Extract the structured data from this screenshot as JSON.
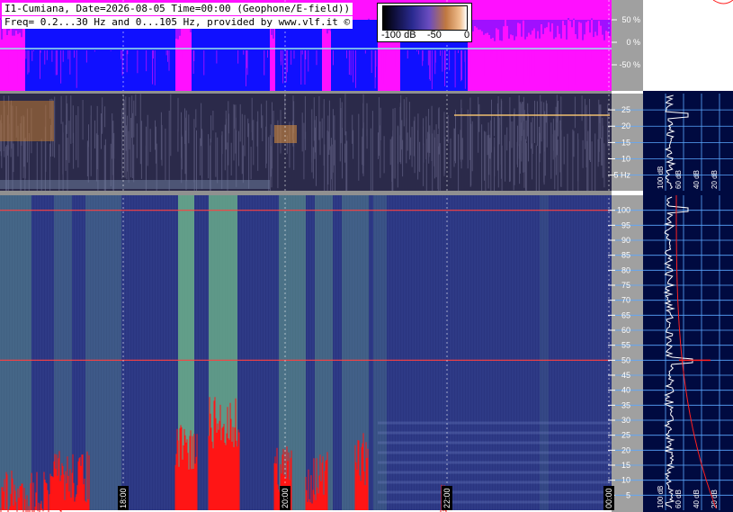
{
  "header": {
    "line1": "I1-Cumiana, Date=2026-08-05 Time=00:00 (Geophone/E-field))",
    "line2": "Freq= 0.2...30 Hz and 0...105 Hz, provided by www.vlf.it ©"
  },
  "colorscale": {
    "labels": [
      "-100 dB",
      "-50",
      "0"
    ]
  },
  "colors": {
    "spectrogram_bg": "#2a3580",
    "panel_bg": "#000a40",
    "grid": "#5aa8ff",
    "trace_red": "#ff2020",
    "percent_blue": "#1010ff",
    "percent_magenta": "#ff10ff",
    "gray_column": "#a0a0a0"
  },
  "chart_data": [
    {
      "type": "area",
      "name": "percentage panel",
      "ylabel": "%",
      "y_ticks": [
        "50 %",
        "0 %",
        "-50 %"
      ],
      "ylim": [
        -100,
        100
      ]
    },
    {
      "type": "heatmap",
      "name": "low-frequency spectrogram",
      "unit_label": "Hz",
      "y_ticks": [
        "25",
        "20",
        "15",
        "10",
        "5 Hz"
      ],
      "y_tick_values": [
        25,
        20,
        15,
        10,
        5
      ],
      "ylim": [
        0.2,
        30
      ],
      "x_ticks": [
        "18:00",
        "20:00",
        "22:00",
        "00:00"
      ],
      "profile_labels": [
        "100 dB",
        "60 dB",
        "40 dB",
        "20 dB"
      ]
    },
    {
      "type": "heatmap",
      "name": "0-105 Hz spectrogram",
      "y_ticks": [
        "100",
        "95",
        "90",
        "85",
        "80",
        "75",
        "70",
        "65",
        "60",
        "55",
        "50",
        "45",
        "40",
        "35",
        "30",
        "25",
        "20",
        "15",
        "10",
        "5"
      ],
      "y_tick_values": [
        100,
        95,
        90,
        85,
        80,
        75,
        70,
        65,
        60,
        55,
        50,
        45,
        40,
        35,
        30,
        25,
        20,
        15,
        10,
        5
      ],
      "ylim": [
        0,
        105
      ],
      "lines_hz": [
        50,
        100
      ],
      "x_ticks": [
        "18:00",
        "20:00",
        "22:00",
        "00:00"
      ],
      "profile_labels": [
        "100 dB",
        "60 dB",
        "40 dB",
        "20 dB"
      ]
    }
  ]
}
